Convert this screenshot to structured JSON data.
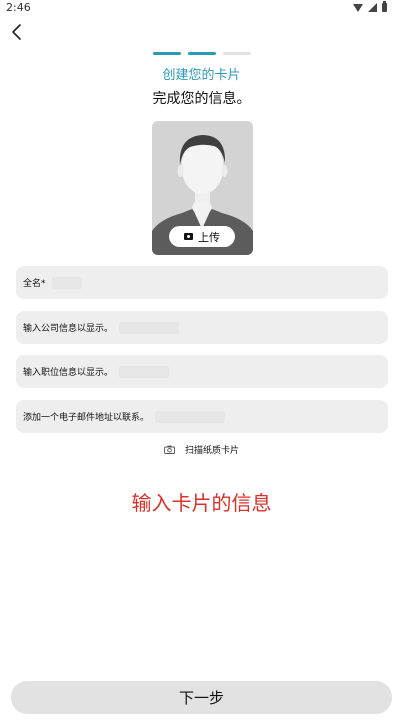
{
  "status_bar": {
    "time": "2:46",
    "icons": [
      "wifi-icon",
      "signal-icon",
      "battery-icon"
    ]
  },
  "nav": {
    "back_icon": "chevron-left-icon"
  },
  "progress": {
    "steps": 3,
    "current": 2,
    "active_color": "#2c9ab7"
  },
  "header": {
    "title": "创建您的卡片",
    "subtitle": "完成您的信息。"
  },
  "avatar": {
    "upload_label": "上传",
    "upload_icon": "camera-icon"
  },
  "form": {
    "full_name": "全名*",
    "company": "输入公司信息以显示。",
    "job_title": "输入职位信息以显示。",
    "email": "添加一个电子邮件地址以联系。"
  },
  "scan": {
    "label": "扫描纸质卡片",
    "icon": "camera-icon"
  },
  "hint": {
    "text": "输入卡片的信息",
    "color": "#d9322b"
  },
  "footer": {
    "next_label": "下一步"
  }
}
